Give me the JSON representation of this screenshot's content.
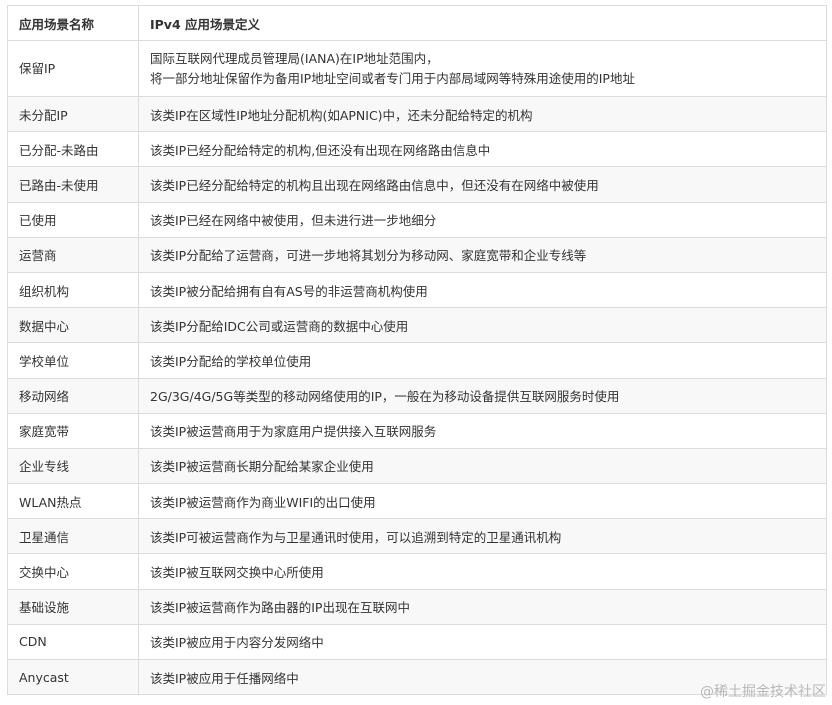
{
  "table": {
    "headers": [
      "应用场景名称",
      "IPv4 应用场景定义"
    ],
    "rows": [
      {
        "name": "保留IP",
        "definition": [
          "国际互联网代理成员管理局(IANA)在IP地址范围内，",
          "将一部分地址保留作为备用IP地址空间或者专门用于内部局域网等特殊用途使用的IP地址"
        ]
      },
      {
        "name": "未分配IP",
        "definition": [
          "该类IP在区域性IP地址分配机构(如APNIC)中，还未分配给特定的机构"
        ]
      },
      {
        "name": "已分配-未路由",
        "definition": [
          "该类IP已经分配给特定的机构,但还没有出现在网络路由信息中"
        ]
      },
      {
        "name": "已路由-未使用",
        "definition": [
          "该类IP已经分配给特定的机构且出现在网络路由信息中，但还没有在网络中被使用"
        ]
      },
      {
        "name": "已使用",
        "definition": [
          "该类IP已经在网络中被使用，但未进行进一步地细分"
        ]
      },
      {
        "name": "运营商",
        "definition": [
          "该类IP分配给了运营商，可进一步地将其划分为移动网、家庭宽带和企业专线等"
        ]
      },
      {
        "name": "组织机构",
        "definition": [
          "该类IP被分配给拥有自有AS号的非运营商机构使用"
        ]
      },
      {
        "name": "数据中心",
        "definition": [
          "该类IP分配给IDC公司或运营商的数据中心使用"
        ]
      },
      {
        "name": "学校单位",
        "definition": [
          "该类IP分配给的学校单位使用"
        ]
      },
      {
        "name": "移动网络",
        "definition": [
          "2G/3G/4G/5G等类型的移动网络使用的IP，一般在为移动设备提供互联网服务时使用"
        ]
      },
      {
        "name": "家庭宽带",
        "definition": [
          "该类IP被运营商用于为家庭用户提供接入互联网服务"
        ]
      },
      {
        "name": "企业专线",
        "definition": [
          "该类IP被运营商长期分配给某家企业使用"
        ]
      },
      {
        "name": "WLAN热点",
        "definition": [
          "该类IP被运营商作为商业WIFI的出口使用"
        ]
      },
      {
        "name": "卫星通信",
        "definition": [
          "该类IP可被运营商作为与卫星通讯时使用，可以追溯到特定的卫星通讯机构"
        ]
      },
      {
        "name": "交换中心",
        "definition": [
          "该类IP被互联网交换中心所使用"
        ]
      },
      {
        "name": "基础设施",
        "definition": [
          "该类IP被运营商作为路由器的IP出现在互联网中"
        ]
      },
      {
        "name": "CDN",
        "definition": [
          "该类IP被应用于内容分发网络中"
        ]
      },
      {
        "name": "Anycast",
        "definition": [
          "该类IP被应用于任播网络中"
        ]
      }
    ]
  },
  "watermark": "@稀土掘金技术社区"
}
